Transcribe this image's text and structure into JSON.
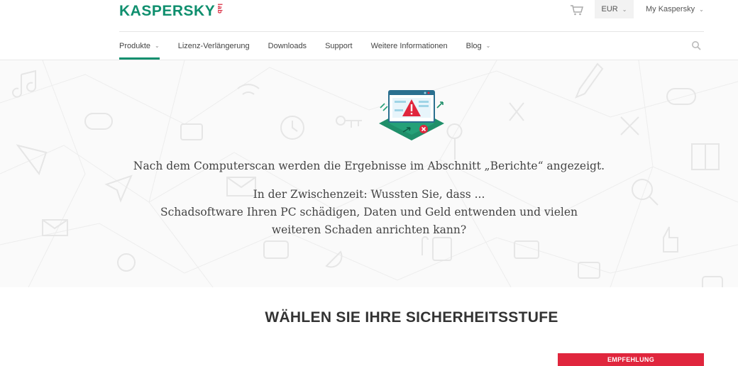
{
  "header": {
    "logo_text": "KASPERSKY",
    "logo_lab": "lab",
    "currency": "EUR",
    "account": "My Kaspersky"
  },
  "nav": {
    "items": [
      {
        "label": "Produkte",
        "has_dropdown": true,
        "active": true
      },
      {
        "label": "Lizenz-Verlängerung",
        "has_dropdown": false,
        "active": false
      },
      {
        "label": "Downloads",
        "has_dropdown": false,
        "active": false
      },
      {
        "label": "Support",
        "has_dropdown": false,
        "active": false
      },
      {
        "label": "Weitere Informationen",
        "has_dropdown": false,
        "active": false
      },
      {
        "label": "Blog",
        "has_dropdown": true,
        "active": false
      }
    ]
  },
  "main": {
    "scan_message": "Nach dem Computerscan werden die Ergebnisse im Abschnitt „Berichte“ angezeigt.",
    "info_line1": "In der Zwischenzeit: Wussten Sie, dass ...",
    "info_line2": "Schadsoftware Ihren PC schädigen, Daten und Geld entwenden und vielen weiteren Schaden anrichten kann?",
    "section_title": "WÄHLEN SIE IHRE SICHERHEITSSTUFE",
    "recommendation_badge": "EMPFEHLUNG"
  },
  "colors": {
    "brand_green": "#0f8f6e",
    "alert_red": "#e0263d"
  }
}
